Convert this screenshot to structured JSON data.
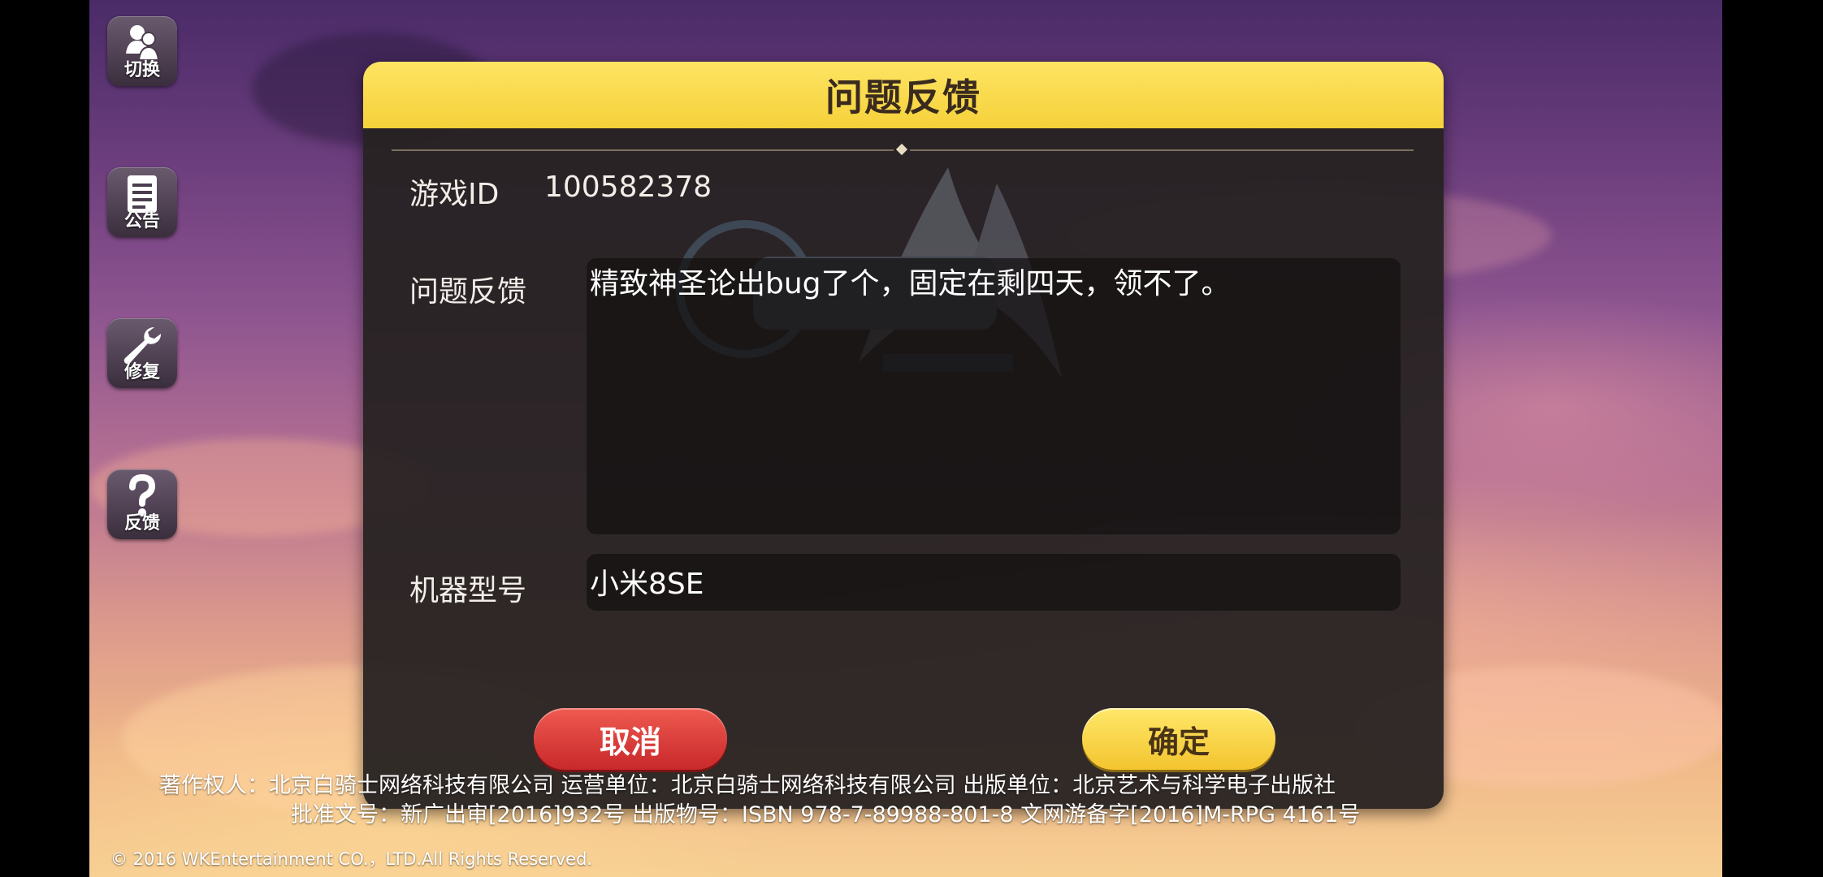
{
  "sidebar": {
    "items": [
      {
        "label": "切换",
        "icon": "switch-account-icon"
      },
      {
        "label": "公告",
        "icon": "notice-icon"
      },
      {
        "label": "修复",
        "icon": "wrench-icon"
      },
      {
        "label": "反馈",
        "icon": "question-icon"
      }
    ]
  },
  "dialog": {
    "title": "问题反馈",
    "game_id_label": "游戏ID",
    "game_id_value": "100582378",
    "feedback_label": "问题反馈",
    "feedback_value": "精致神圣论出bug了个，固定在剩四天，领不了。",
    "device_label": "机器型号",
    "device_value": "小米8SE",
    "cancel_label": "取消",
    "confirm_label": "确定"
  },
  "footer": {
    "line1": "著作权人：北京白骑士网络科技有限公司  运营单位：北京白骑士网络科技有限公司  出版单位：北京艺术与科学电子出版社",
    "line2": "批准文号：新广出审[2016]932号  出版物号：ISBN 978-7-89988-801-8  文网游备字[2016]M-RPG 4161号",
    "copyright": "© 2016 WKEntertainment CO.，LTD.All Rights Reserved."
  },
  "colors": {
    "title_bar": "#f6d13a",
    "cancel_button": "#d83a36",
    "confirm_button": "#f6d042",
    "panel": "#262222"
  }
}
